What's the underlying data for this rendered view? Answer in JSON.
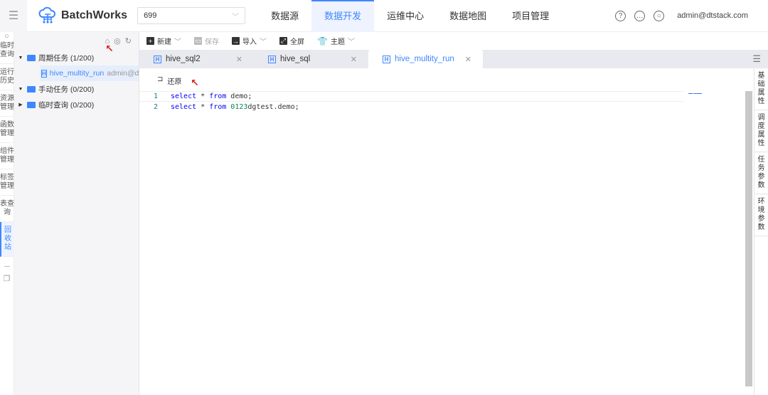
{
  "header": {
    "brand": "BatchWorks",
    "project_select": "699",
    "nav": [
      "数据源",
      "数据开发",
      "运维中心",
      "数据地图",
      "项目管理"
    ],
    "active_nav": 1,
    "user": "admin@dtstack.com"
  },
  "leftnav": [
    "临时查询",
    "运行历史",
    "资源管理",
    "函数管理",
    "组件管理",
    "标签管理",
    "表查询",
    "回收站"
  ],
  "leftnav_more": "...",
  "tree": {
    "folders": [
      {
        "label": "周期任务 (1/200)",
        "expanded": true
      },
      {
        "label": "手动任务 (0/200)",
        "expanded": true
      },
      {
        "label": "临时查询 (0/200)",
        "expanded": false
      }
    ],
    "task": {
      "name": "hive_multity_run",
      "owner": "admin@dtst"
    }
  },
  "toolbar": {
    "new": "新建",
    "save": "保存",
    "import": "导入",
    "fullscreen": "全屏",
    "theme": "主题"
  },
  "tabs": [
    "hive_sql2",
    "hive_sql",
    "hive_multity_run"
  ],
  "editor": {
    "restore": "还原",
    "lines": [
      {
        "num": "1",
        "kw1": "select",
        "op": " * ",
        "kw2": "from",
        "rest": " demo;",
        "numlit": ""
      },
      {
        "num": "2",
        "kw1": "select",
        "op": " * ",
        "kw2": "from",
        "numlit": " 0123",
        "rest": "dgtest.demo;"
      }
    ]
  },
  "rightpanel": [
    "基础属性",
    "调度属性",
    "任务参数",
    "环境参数"
  ],
  "accent": "#3f87ff"
}
